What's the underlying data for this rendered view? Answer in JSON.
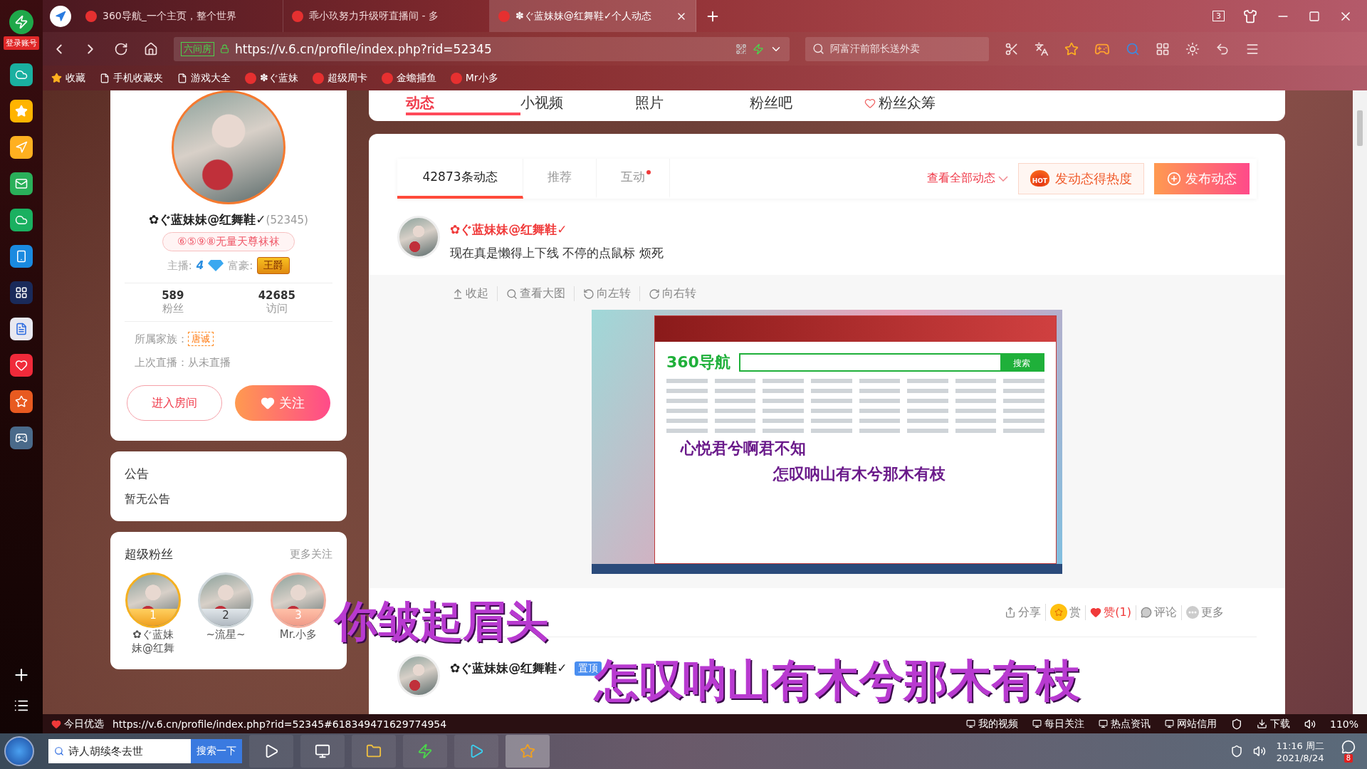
{
  "browser": {
    "login_label": "登录账号",
    "tabs": [
      {
        "label": "360导航_一个主页，整个世界",
        "selected": false
      },
      {
        "label": "乖小玖努力升级呀直播间 - 多",
        "selected": false
      },
      {
        "label": "✽ぐ蓝妹妹@红舞鞋✓个人动态",
        "selected": true
      }
    ],
    "tab_count": "3",
    "address": {
      "site_tag": "六间房",
      "url": "https://v.6.cn/profile/index.php?rid=52345"
    },
    "search": {
      "placeholder": "阿富汗前部长送外卖"
    },
    "bookmarks": [
      "收藏",
      "手机收藏夹",
      "游戏大全",
      "✽ぐ蓝妹",
      "超级周卡",
      "金蟾捕鱼",
      "Mr小多"
    ]
  },
  "profile": {
    "name": "✿ぐ蓝妹妹@红舞鞋✓",
    "room_id": "(52345)",
    "badge": "⑥⑤⑨⑧无量天尊袜袜",
    "anchor_label": "主播:",
    "anchor_level": "4",
    "wealth_label": "富豪:",
    "wealth_title": "王爵",
    "stats": [
      {
        "value": "589",
        "label": "粉丝"
      },
      {
        "value": "42685",
        "label": "访问"
      }
    ],
    "family_label": "所属家族：",
    "family": "唐诚",
    "last_live": "上次直播：从未直播",
    "enter_button": "进入房间",
    "follow_button": "关注"
  },
  "announcement": {
    "title": "公告",
    "text": "暂无公告"
  },
  "super_fans": {
    "title": "超级粉丝",
    "more": "更多关注",
    "fans": [
      {
        "rank": "1",
        "name": "✿ぐ蓝妹妹@红舞"
      },
      {
        "rank": "2",
        "name": "~流星~"
      },
      {
        "rank": "3",
        "name": "Mr.小多"
      }
    ]
  },
  "nav_tabs": [
    {
      "label": "动态",
      "selected": true
    },
    {
      "label": "小视频",
      "selected": false
    },
    {
      "label": "照片",
      "selected": false
    },
    {
      "label": "粉丝吧",
      "selected": false
    },
    {
      "label": "粉丝众筹",
      "selected": false
    }
  ],
  "feed": {
    "tabs": [
      {
        "label": "42873条动态",
        "selected": true,
        "dot": false
      },
      {
        "label": "推荐",
        "selected": false,
        "dot": false
      },
      {
        "label": "互动",
        "selected": false,
        "dot": true
      }
    ],
    "filter": "查看全部动态",
    "hot_badge": "HOT",
    "hot_button": "发动态得热度",
    "publish_button": "发布动态",
    "post": {
      "author": "✿ぐ蓝妹妹@红舞鞋✓",
      "text": "现在真是懒得上下线 不停的点鼠标 烦死",
      "tools": [
        "收起",
        "查看大图",
        "向左转",
        "向右转"
      ],
      "screenshot": {
        "logo": "360导航",
        "search_button": "搜索",
        "captions": [
          "心悦君兮啊君不知",
          "怎叹呐山有木兮那木有枝"
        ]
      },
      "actions": {
        "share": "分享",
        "reward": "赏",
        "like": "赞(1)",
        "comment": "评论",
        "more": "更多"
      }
    },
    "pinned_post": {
      "author": "✿ぐ蓝妹妹@红舞鞋✓",
      "tag": "置顶"
    }
  },
  "lyrics": [
    "你皱起眉头",
    "怎叹呐山有木兮那木有枝"
  ],
  "status_bar": {
    "promo": "今日优选",
    "link": "https://v.6.cn/profile/index.php?rid=52345#618349471629774954",
    "items": [
      "我的视频",
      "每日关注",
      "热点资讯",
      "网站信用"
    ],
    "download": "下载",
    "zoom": "110%"
  },
  "taskbar": {
    "search_value": "诗人胡续冬去世",
    "search_button": "搜索一下",
    "time": "11:16 周二",
    "date": "2021/8/24",
    "notifications": "8"
  }
}
